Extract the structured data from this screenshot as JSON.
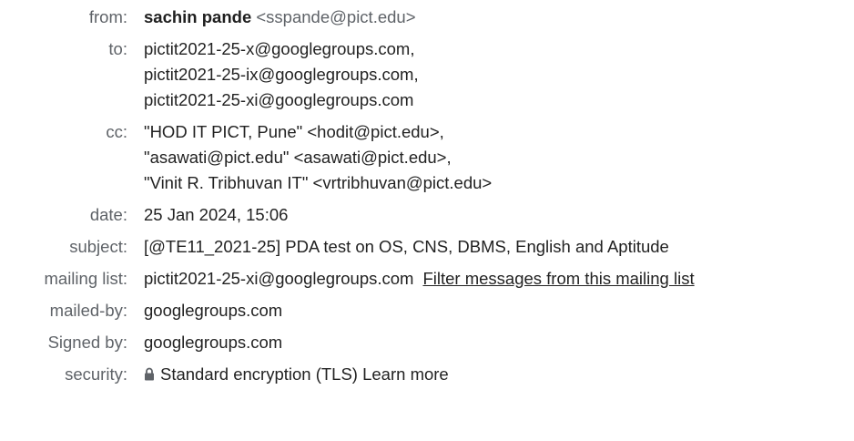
{
  "labels": {
    "from": "from:",
    "to": "to:",
    "cc": "cc:",
    "date": "date:",
    "subject": "subject:",
    "mailing_list": "mailing list:",
    "mailed_by": "mailed-by:",
    "signed_by": "Signed by:",
    "security": "security:"
  },
  "from": {
    "name": "sachin pande",
    "email": "<sspande@pict.edu>"
  },
  "to": [
    "pictit2021-25-x@googlegroups.com,",
    "pictit2021-25-ix@googlegroups.com,",
    "pictit2021-25-xi@googlegroups.com"
  ],
  "cc": [
    "\"HOD IT PICT, Pune\" <hodit@pict.edu>,",
    "\"asawati@pict.edu\" <asawati@pict.edu>,",
    "\"Vinit R. Tribhuvan IT\" <vrtribhuvan@pict.edu>"
  ],
  "date": "25 Jan 2024, 15:06",
  "subject": "[@TE11_2021-25] PDA test on OS, CNS, DBMS, English and Aptitude",
  "mailing_list": {
    "address": "pictit2021-25-xi@googlegroups.com",
    "filter_link": "Filter messages from this mailing list"
  },
  "mailed_by": "googlegroups.com",
  "signed_by": "googlegroups.com",
  "security": {
    "icon": "lock-icon",
    "text": "Standard encryption (TLS)",
    "learn_more": "Learn more"
  },
  "colors": {
    "label": "#5f6368",
    "text": "#222222"
  }
}
